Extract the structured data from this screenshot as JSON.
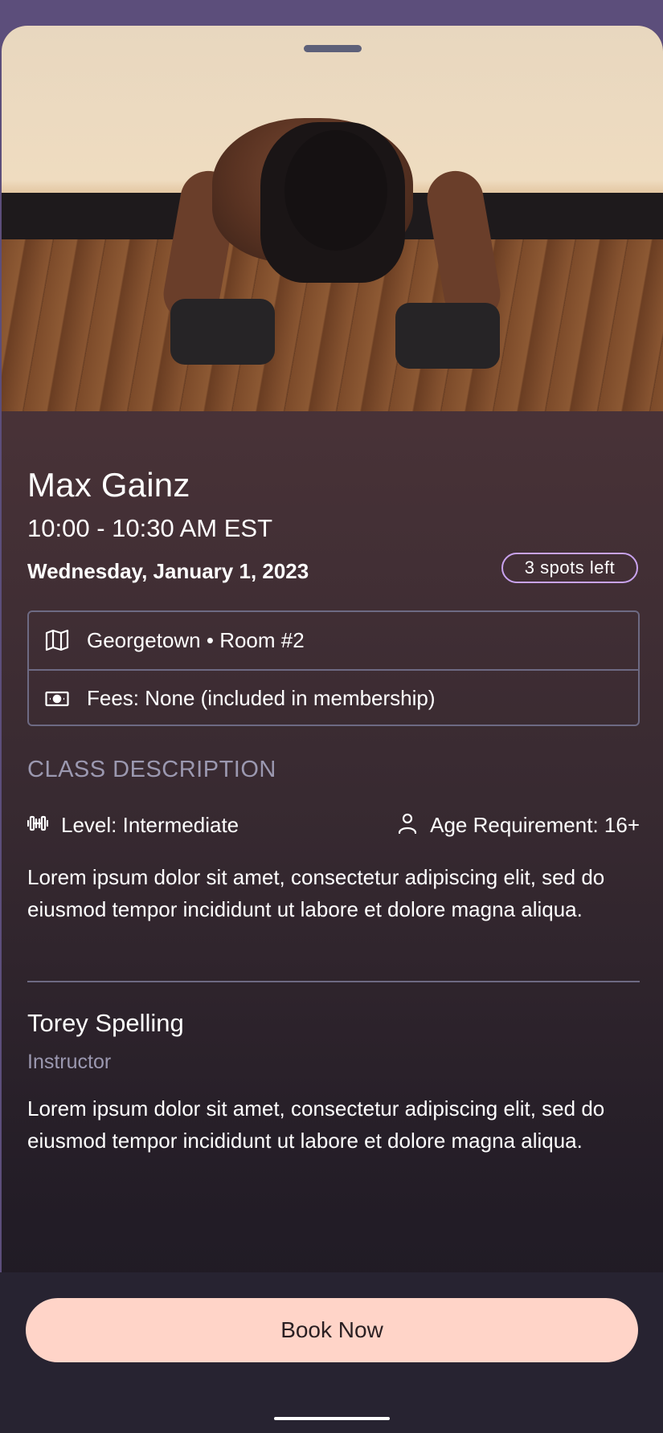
{
  "class": {
    "name": "Max Gainz",
    "time": "10:00 - 10:30 AM EST",
    "date": "Wednesday, January 1, 2023",
    "spots_left": "3 spots left"
  },
  "info": {
    "location": "Georgetown • Room #2",
    "location_icon": "map-icon",
    "fees": "Fees: None (included in membership)",
    "fees_icon": "cash-icon"
  },
  "description": {
    "heading": "CLASS DESCRIPTION",
    "level": "Level: Intermediate",
    "level_icon": "dumbbell-icon",
    "age": "Age Requirement: 16+",
    "age_icon": "person-icon",
    "text": "Lorem ipsum dolor sit amet, consectetur adipiscing elit, sed do eiusmod tempor incididunt ut labore et dolore magna aliqua."
  },
  "instructor": {
    "name": "Torey Spelling",
    "role": "Instructor",
    "bio": "Lorem ipsum dolor sit amet, consectetur adipiscing elit, sed do eiusmod tempor incididunt ut labore et dolore magna aliqua."
  },
  "actions": {
    "book_label": "Book Now"
  },
  "colors": {
    "accent_button": "#ffd4c8",
    "badge_border": "#c9a3ef",
    "muted_text": "#9b98b0",
    "status_bar": "#5c4e7b"
  }
}
